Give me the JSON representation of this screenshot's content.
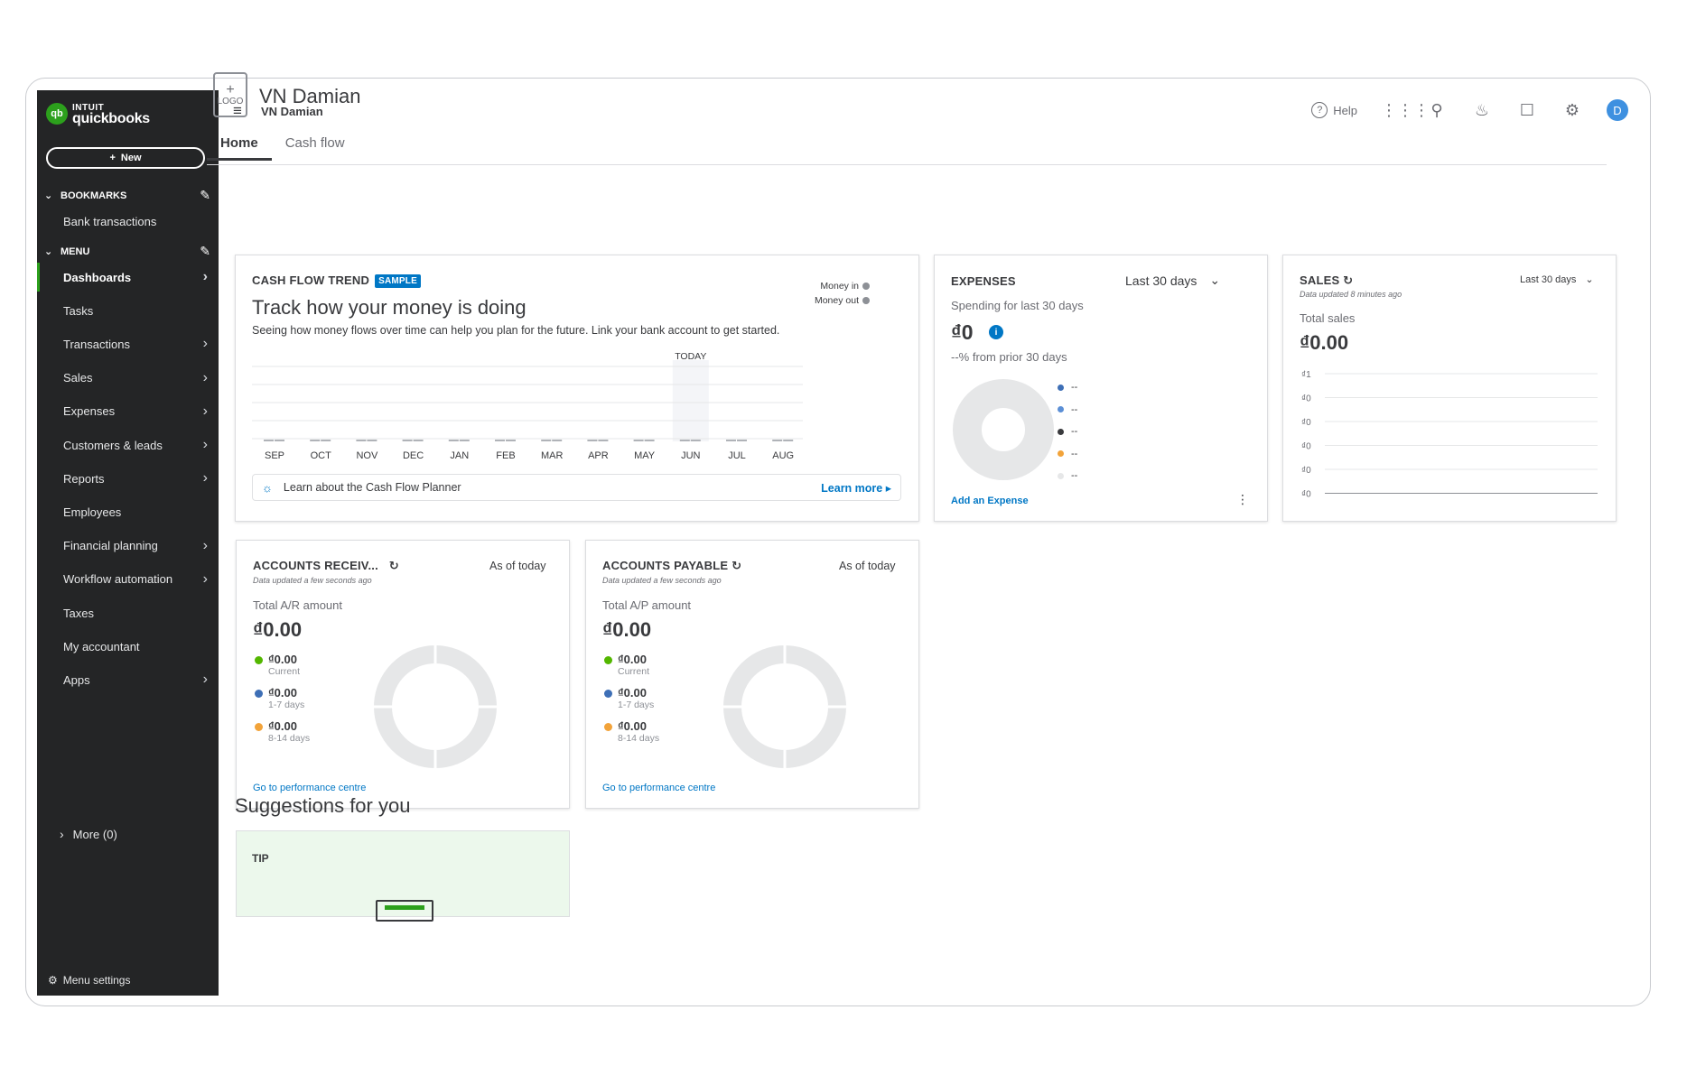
{
  "sidebar": {
    "brand_intuit": "INTUIT",
    "brand_name": "quickbooks",
    "new_button": "New",
    "bookmarks_label": "BOOKMARKS",
    "bookmarks": [
      "Bank transactions"
    ],
    "menu_label": "MENU",
    "items": [
      {
        "label": "Dashboards",
        "arrow": true,
        "active": true
      },
      {
        "label": "Tasks",
        "arrow": false
      },
      {
        "label": "Transactions",
        "arrow": true
      },
      {
        "label": "Sales",
        "arrow": true
      },
      {
        "label": "Expenses",
        "arrow": true
      },
      {
        "label": "Customers & leads",
        "arrow": true
      },
      {
        "label": "Reports",
        "arrow": true
      },
      {
        "label": "Employees",
        "arrow": false
      },
      {
        "label": "Financial planning",
        "arrow": true
      },
      {
        "label": "Workflow automation",
        "arrow": true
      },
      {
        "label": "Taxes",
        "arrow": false
      },
      {
        "label": "My accountant",
        "arrow": false
      },
      {
        "label": "Apps",
        "arrow": true
      }
    ],
    "more": "More (0)",
    "menu_settings": "Menu settings"
  },
  "topbar": {
    "company": "VN Damian",
    "help": "Help",
    "avatar_initial": "D"
  },
  "header": {
    "logo_text": "LOGO",
    "logo_plus": "+",
    "title": "VN Damian",
    "tabs": [
      "Home",
      "Cash flow"
    ]
  },
  "cashflow": {
    "title": "CASH FLOW TREND",
    "badge": "SAMPLE",
    "headline": "Track how your money is doing",
    "description": "Seeing how money flows over time can help you plan for the future. Link your bank account to get started.",
    "legend_in": "Money in",
    "legend_out": "Money out",
    "today": "TODAY",
    "learn_text": "Learn about the Cash Flow Planner",
    "learn_more": "Learn more"
  },
  "chart_data": {
    "type": "bar",
    "categories": [
      "SEP",
      "OCT",
      "NOV",
      "DEC",
      "JAN",
      "FEB",
      "MAR",
      "APR",
      "MAY",
      "JUN",
      "JUL",
      "AUG"
    ],
    "series": [
      {
        "name": "Money in",
        "values": [
          0,
          0,
          0,
          0,
          0,
          0,
          0,
          0,
          0,
          0,
          0,
          0
        ]
      },
      {
        "name": "Money out",
        "values": [
          0,
          0,
          0,
          0,
          0,
          0,
          0,
          0,
          0,
          0,
          0,
          0
        ]
      }
    ],
    "today_category": "JUN",
    "grid": true
  },
  "expenses": {
    "title": "EXPENSES",
    "period": "Last 30 days",
    "subtitle": "Spending for last 30 days",
    "amount": "₫0",
    "change": "--% from prior 30 days",
    "legend": [
      {
        "label": "--",
        "color": "#3e6fb6"
      },
      {
        "label": "--",
        "color": "#5b8fd6"
      },
      {
        "label": "--",
        "color": "#393a3d"
      },
      {
        "label": "--",
        "color": "#f2a33a"
      },
      {
        "label": "--",
        "color": "#e6e7e8"
      }
    ],
    "add_link": "Add an Expense"
  },
  "sales": {
    "title": "SALES",
    "period": "Last 30 days",
    "updated": "Data updated 8 minutes ago",
    "total_label": "Total sales",
    "amount": "₫0.00",
    "y_ticks": [
      "₫1",
      "₫0",
      "₫0",
      "₫0",
      "₫0",
      "₫0"
    ]
  },
  "ar": {
    "title": "ACCOUNTS RECEIV...",
    "as_of": "As of today",
    "updated": "Data updated a few seconds ago",
    "total_label": "Total A/R amount",
    "amount": "₫0.00",
    "aging": [
      {
        "amount": "₫0.00",
        "label": "Current",
        "color": "#53b700"
      },
      {
        "amount": "₫0.00",
        "label": "1-7 days",
        "color": "#3e6fb6"
      },
      {
        "amount": "₫0.00",
        "label": "8-14 days",
        "color": "#f2a33a"
      }
    ],
    "link": "Go to performance centre"
  },
  "ap": {
    "title": "ACCOUNTS PAYABLE",
    "as_of": "As of today",
    "updated": "Data updated a few seconds ago",
    "total_label": "Total A/P amount",
    "amount": "₫0.00",
    "aging": [
      {
        "amount": "₫0.00",
        "label": "Current",
        "color": "#53b700"
      },
      {
        "amount": "₫0.00",
        "label": "1-7 days",
        "color": "#3e6fb6"
      },
      {
        "amount": "₫0.00",
        "label": "8-14 days",
        "color": "#f2a33a"
      }
    ],
    "link": "Go to performance centre"
  },
  "suggestions": {
    "title": "Suggestions for you",
    "tip_label": "TIP"
  }
}
